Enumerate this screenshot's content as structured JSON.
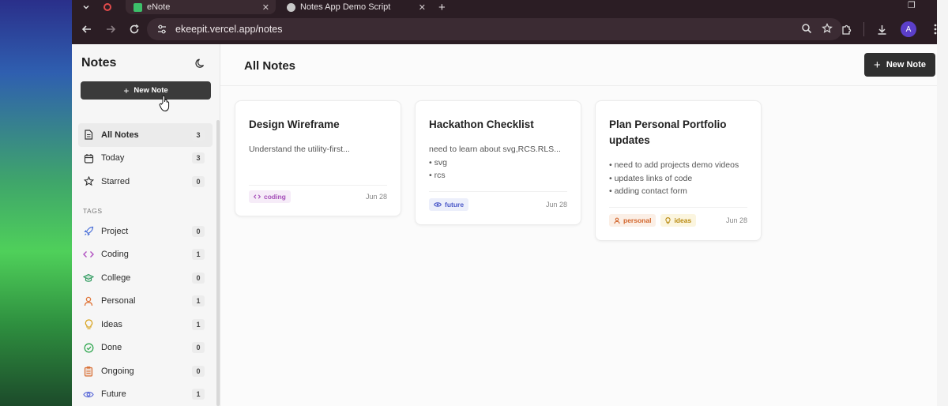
{
  "browser": {
    "tabs": [
      {
        "title": "eNote",
        "active": true
      },
      {
        "title": "Notes App Demo Script",
        "active": false
      }
    ],
    "new_tab": "+",
    "url": "ekeepit.vercel.app/notes",
    "profile_initial": "A"
  },
  "sidebar": {
    "title": "Notes",
    "new_note_label": "New Note",
    "nav": [
      {
        "label": "All Notes",
        "count": "3",
        "icon": "file-icon",
        "selected": true
      },
      {
        "label": "Today",
        "count": "3",
        "icon": "calendar-icon"
      },
      {
        "label": "Starred",
        "count": "0",
        "icon": "star-icon"
      }
    ],
    "tags_heading": "TAGS",
    "tags": [
      {
        "label": "Project",
        "count": "0",
        "icon": "rocket-icon",
        "color": "#4a6fd8"
      },
      {
        "label": "Coding",
        "count": "1",
        "icon": "code-icon",
        "color": "#b04fc0"
      },
      {
        "label": "College",
        "count": "0",
        "icon": "graduation-cap-icon",
        "color": "#2f9a5f"
      },
      {
        "label": "Personal",
        "count": "1",
        "icon": "person-icon",
        "color": "#e0763a"
      },
      {
        "label": "Ideas",
        "count": "1",
        "icon": "lightbulb-icon",
        "color": "#d8a21c"
      },
      {
        "label": "Done",
        "count": "0",
        "icon": "check-circle-icon",
        "color": "#34a853"
      },
      {
        "label": "Ongoing",
        "count": "0",
        "icon": "clipboard-icon",
        "color": "#d9733a"
      },
      {
        "label": "Future",
        "count": "1",
        "icon": "eye-icon",
        "color": "#5b6ad8"
      }
    ]
  },
  "main": {
    "title": "All Notes",
    "new_note_label": "New Note",
    "notes": [
      {
        "title": "Design Wireframe",
        "lines": [
          "Understand the utility-first..."
        ],
        "tags": [
          {
            "label": "coding",
            "icon": "code-icon",
            "color": "#a44db8",
            "bg": "#f6ecf8"
          }
        ],
        "date": "Jun 28"
      },
      {
        "title": "Hackathon Checklist",
        "lines": [
          "need to learn about svg,RCS.RLS...",
          "• svg",
          "• rcs"
        ],
        "tags": [
          {
            "label": "future",
            "icon": "eye-icon",
            "color": "#4a58c8",
            "bg": "#eceffb"
          }
        ],
        "date": "Jun 28"
      },
      {
        "title": "Plan Personal Portfolio updates",
        "lines": [
          "• need to add projects demo videos",
          "• updates links of code",
          "• adding contact form"
        ],
        "tags": [
          {
            "label": "personal",
            "icon": "person-icon",
            "color": "#d2642a",
            "bg": "#fbefe6"
          },
          {
            "label": "ideas",
            "icon": "lightbulb-icon",
            "color": "#b98a10",
            "bg": "#fbf5df"
          }
        ],
        "date": "Jun 28"
      }
    ]
  }
}
